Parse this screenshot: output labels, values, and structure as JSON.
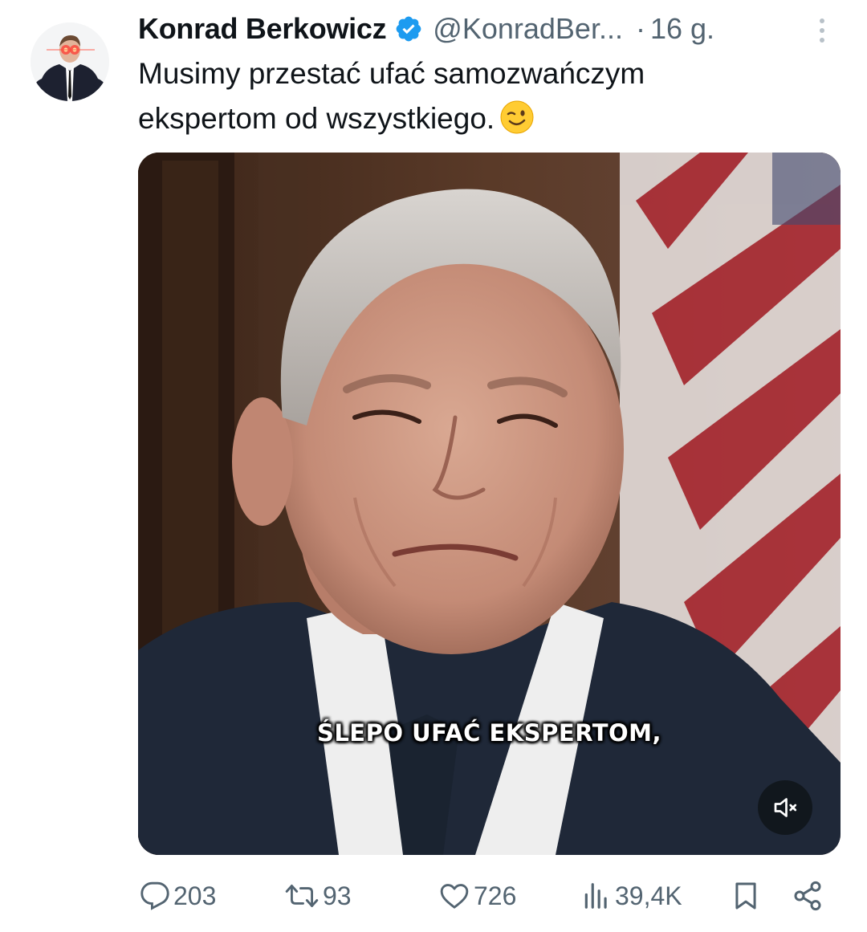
{
  "author": {
    "display_name": "Konrad Berkowicz",
    "handle": "@KonradBer...",
    "separator": "·",
    "time": "16 g."
  },
  "tweet": {
    "text_line1": "Musimy przestać ufać samozwańczym",
    "text_line2": "ekspertom od wszystkiego.",
    "emoji": "winking-face"
  },
  "media": {
    "caption": "ŚLEPO UFAĆ EKSPERTOM,",
    "sound_state": "muted"
  },
  "actions": {
    "replies": "203",
    "retweets": "93",
    "likes": "726",
    "views": "39,4K"
  },
  "colors": {
    "verified": "#1d9bf0",
    "secondary_text": "#536471",
    "primary_text": "#0f1419"
  },
  "icons": [
    "verified-badge-icon",
    "more-icon",
    "mute-icon",
    "reply-icon",
    "retweet-icon",
    "like-icon",
    "views-icon",
    "bookmark-icon",
    "share-icon"
  ]
}
